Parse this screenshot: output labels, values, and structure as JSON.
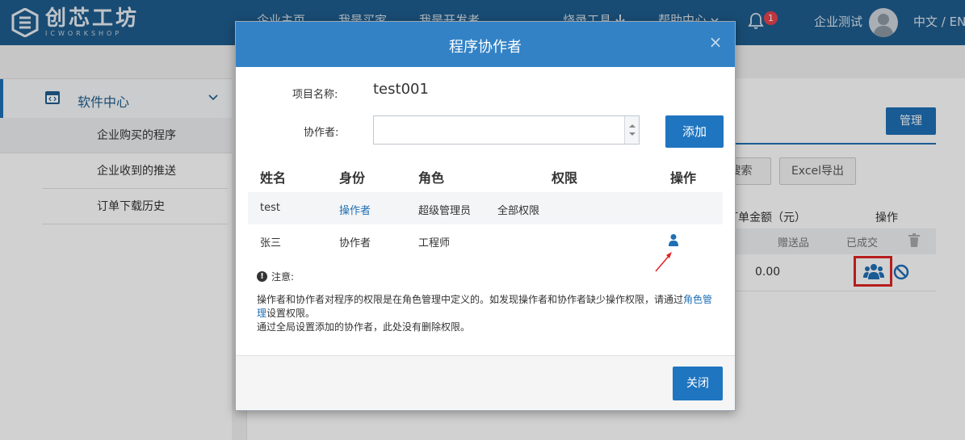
{
  "header": {
    "logo_cn": "创芯工坊",
    "logo_en": "ICWORKSHOP",
    "nav": [
      "企业主页",
      "我是买家",
      "我是开发者"
    ],
    "tools_label": "烧录工具",
    "help_label": "帮助中心",
    "notification_count": "1",
    "username": "企业测试",
    "language": "中文 / EN"
  },
  "sidebar": {
    "section_label": "软件中心",
    "items": [
      "企业购买的程序",
      "企业收到的推送",
      "订单下载历史"
    ]
  },
  "background": {
    "manage_label": "管理",
    "search_label": "搜索",
    "export_label": "Excel导出",
    "amount_header": "订单金额（元）",
    "action_header": "操作",
    "gift_label": "赠送品",
    "done_label": "已成交",
    "amount_value": "0.00"
  },
  "modal": {
    "title": "程序协作者",
    "close_symbol": "×",
    "project_label": "项目名称:",
    "project_value": "test001",
    "collaborator_label": "协作者:",
    "collaborator_value": "",
    "add_label": "添加",
    "columns": [
      "姓名",
      "身份",
      "角色",
      "权限",
      "操作"
    ],
    "rows": [
      {
        "name": "test",
        "identity": "操作者",
        "role": "超级管理员",
        "permission": "全部权限"
      },
      {
        "name": "张三",
        "identity": "协作者",
        "role": "工程师",
        "permission": ""
      }
    ],
    "note_title": "注意:",
    "note_line1_pre": "操作者和协作者对程序的权限是在角色管理中定义的。如发现操作者和协作者缺少操作权限，请通过",
    "note_link": "角色管理",
    "note_line1_post": "设置权限。",
    "note_line2": "通过全局设置添加的协作者，此处没有删除权限。",
    "close_label": "关闭"
  },
  "colors": {
    "header_bg": "#1f5d8e",
    "modal_header": "#3382c6",
    "primary_button": "#1f75bf",
    "link": "#1f6fb5",
    "highlight": "#e02424"
  }
}
